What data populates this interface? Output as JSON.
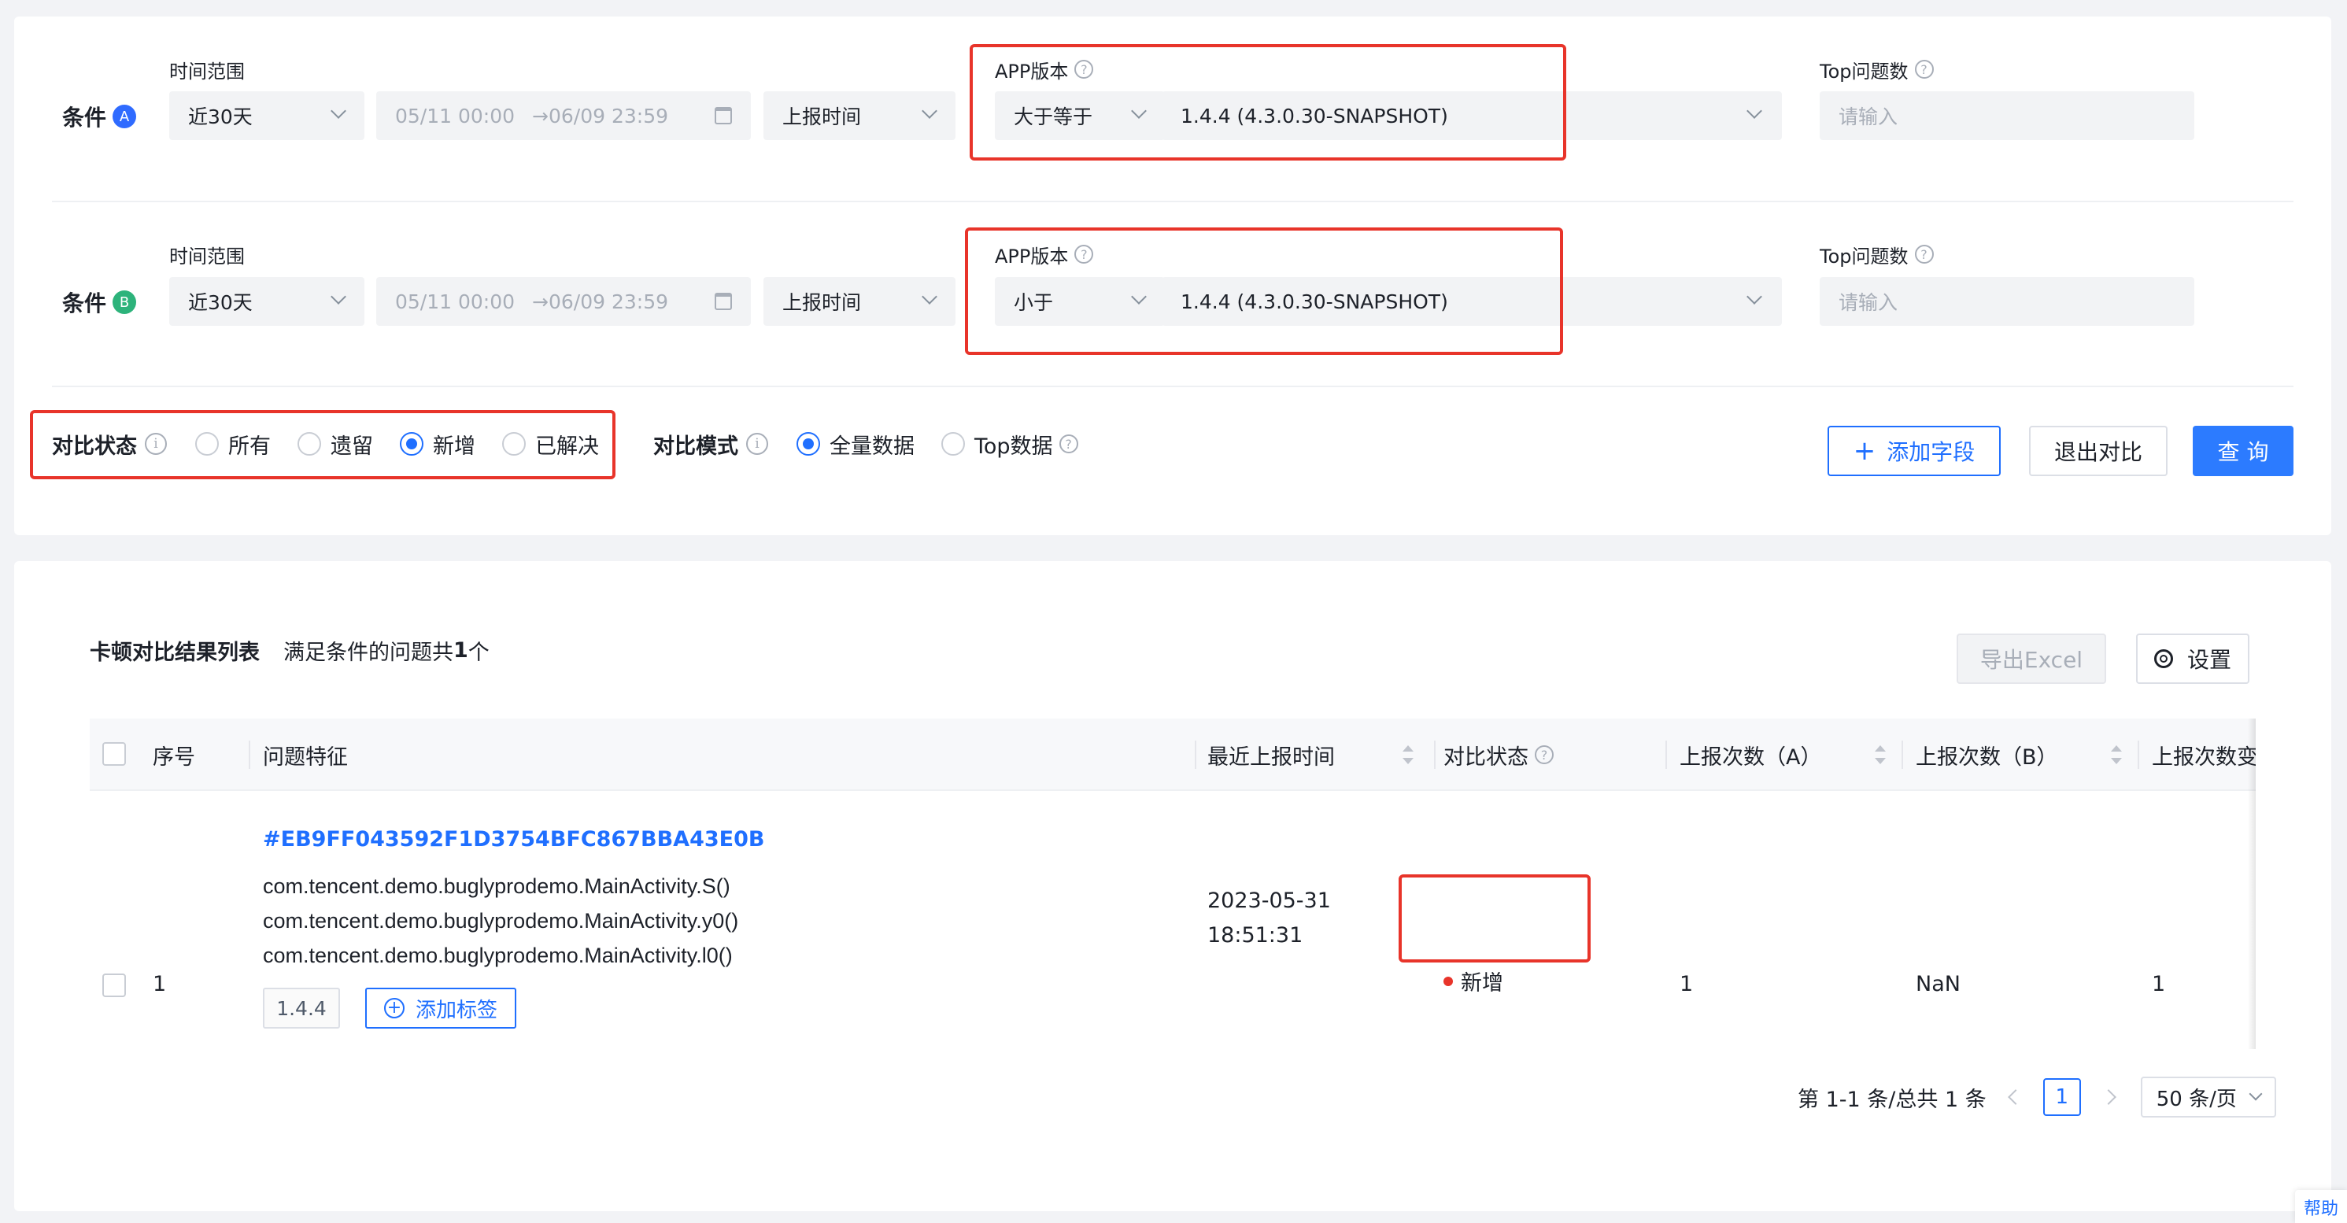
{
  "filter": {
    "condA": {
      "label": "条件",
      "badge": "A",
      "badge_color": "#2f6bff",
      "time_range_label": "时间范围",
      "time_range_value": "近30天",
      "date_start": "05/11 00:00",
      "date_arrow": "→",
      "date_end": "06/09 23:59",
      "time_type": "上报时间",
      "app_version_label": "APP版本",
      "operator": "大于等于",
      "version": "1.4.4 (4.3.0.30-SNAPSHOT)",
      "top_label": "Top问题数",
      "top_placeholder": "请输入"
    },
    "condB": {
      "label": "条件",
      "badge": "B",
      "badge_color": "#2db37b",
      "time_range_label": "时间范围",
      "time_range_value": "近30天",
      "date_start": "05/11 00:00",
      "date_arrow": "→",
      "date_end": "06/09 23:59",
      "time_type": "上报时间",
      "app_version_label": "APP版本",
      "operator": "小于",
      "version": "1.4.4 (4.3.0.30-SNAPSHOT)",
      "top_label": "Top问题数",
      "top_placeholder": "请输入"
    },
    "compare_status": {
      "label": "对比状态",
      "options": [
        "所有",
        "遗留",
        "新增",
        "已解决"
      ],
      "selected": "新增"
    },
    "compare_mode": {
      "label": "对比模式",
      "options": [
        "全量数据",
        "Top数据"
      ],
      "selected": "全量数据"
    },
    "buttons": {
      "add_field": "添加字段",
      "exit_compare": "退出对比",
      "query": "查 询"
    }
  },
  "results": {
    "title": "卡顿对比结果列表",
    "summary_prefix": "满足条件的问题共",
    "summary_count": "1",
    "summary_suffix": "个",
    "export_label": "导出Excel",
    "settings_label": "设置",
    "columns": [
      "序号",
      "问题特征",
      "最近上报时间",
      "对比状态",
      "上报次数（A）",
      "上报次数（B）",
      "上报次数变"
    ],
    "rows": [
      {
        "index": "1",
        "issue_id": "#EB9FF043592F1D3754BFC867BBA43E0B",
        "stack": [
          "com.tencent.demo.buglyprodemo.MainActivity.S()",
          "com.tencent.demo.buglyprodemo.MainActivity.y0()",
          "com.tencent.demo.buglyprodemo.MainActivity.l0()"
        ],
        "version_tag": "1.4.4",
        "add_tag_label": "添加标签",
        "last_report_date": "2023-05-31",
        "last_report_time": "18:51:31",
        "status": "新增",
        "status_color": "#e8342a",
        "count_a": "1",
        "count_b": "NaN",
        "count_change": "1"
      }
    ],
    "pagination": {
      "summary": "第 1-1 条/总共 1 条",
      "current_page": "1",
      "page_size": "50 条/页"
    }
  },
  "help_label": "帮助"
}
